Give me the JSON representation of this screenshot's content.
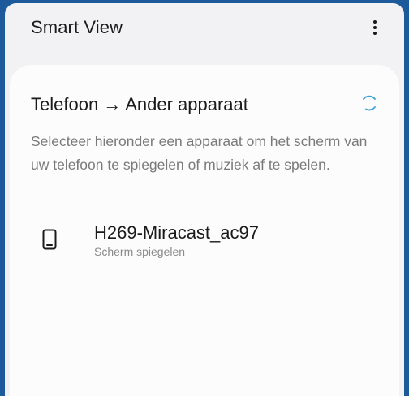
{
  "app_bar": {
    "title": "Smart View",
    "more_icon": "more-vertical-icon"
  },
  "section": {
    "title": "Telefoon → Ander apparaat",
    "spinner_icon": "loading-spinner-icon",
    "description": "Selecteer hieronder een apparaat om het scherm van uw telefoon te spiegelen of muziek af te spelen."
  },
  "devices": [
    {
      "name": "H269-Miracast_ac97",
      "status": "Scherm spiegelen",
      "icon": "phone-icon"
    }
  ],
  "colors": {
    "background": "#f2f2f4",
    "card": "#fcfcfc",
    "accent": "#3aa0d8",
    "frame": "#1f5c9e"
  }
}
